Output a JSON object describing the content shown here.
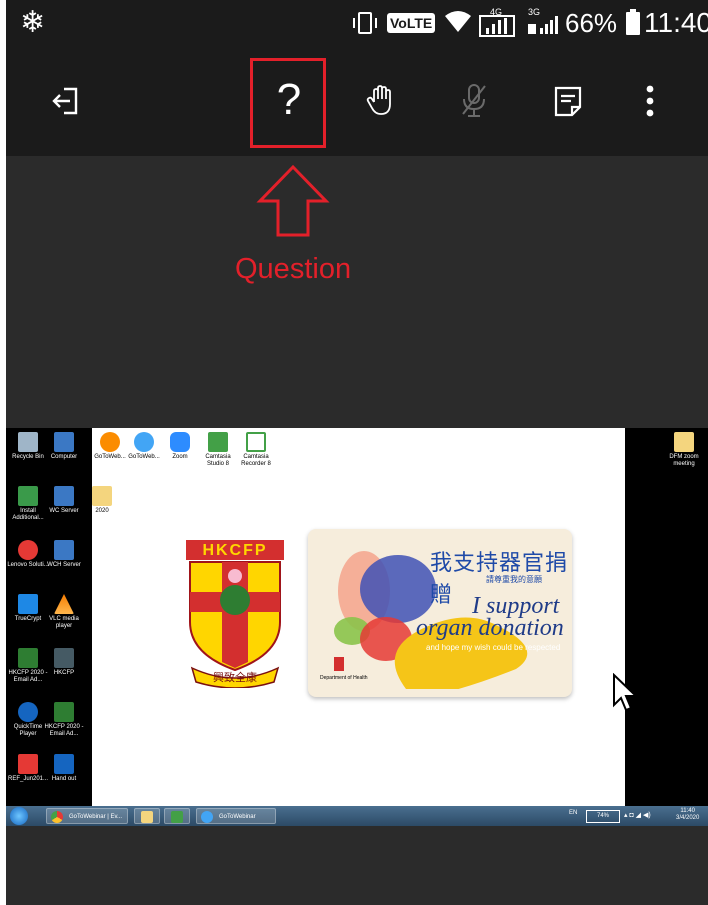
{
  "status_bar": {
    "volte": "VoLTE",
    "net1": "4G",
    "net2": "3G",
    "battery": "66%",
    "time": "11:40"
  },
  "toolbar": {
    "help_glyph": "?",
    "icons": [
      "exit-icon",
      "help-icon",
      "raise-hand-icon",
      "microphone-muted-icon",
      "notes-icon",
      "more-options-icon"
    ]
  },
  "annotation": {
    "label": "Question",
    "color": "#e3202a"
  },
  "desktop": {
    "left_icons": [
      {
        "label": "Recycle Bin"
      },
      {
        "label": "Computer"
      },
      {
        "label": "Install Additional..."
      },
      {
        "label": "WC Server"
      },
      {
        "label": "Lenovo Soluti..."
      },
      {
        "label": "WCH Server"
      },
      {
        "label": "TrueCrypt"
      },
      {
        "label": "VLC media player"
      },
      {
        "label": "HKCFP 2020 - Email Ad..."
      },
      {
        "label": "HKCFP"
      },
      {
        "label": "QuickTime Player"
      },
      {
        "label": "HKCFP 2020 - Email Ad..."
      },
      {
        "label": "REF_Jun201..."
      },
      {
        "label": "Hand out"
      }
    ],
    "top_icons": [
      {
        "label": "GoToWeb..."
      },
      {
        "label": "GoToWeb..."
      },
      {
        "label": "Zoom"
      },
      {
        "label": "Camtasia Studio 8"
      },
      {
        "label": "Camtasia Recorder 8"
      }
    ],
    "folder_label": "2020",
    "right_icon": {
      "label": "DFM zoom meeting"
    },
    "hkcfp_logo": {
      "letters": "HKCFP",
      "motto": "興致全康"
    },
    "card": {
      "cn_title": "我支持器官捐贈",
      "cn_sub": "請尊重我的意願",
      "en_line1": "I support",
      "en_line2": "organ donation",
      "en_line3": "and hope my wish could be respected",
      "dept": "Department of Health"
    },
    "taskbar": {
      "items": [
        "GoToWebinar | Ev...",
        "GoToWebinar"
      ],
      "lang": "EN",
      "battery": "74%",
      "time": "11:40",
      "date": "3/4/2020"
    }
  }
}
